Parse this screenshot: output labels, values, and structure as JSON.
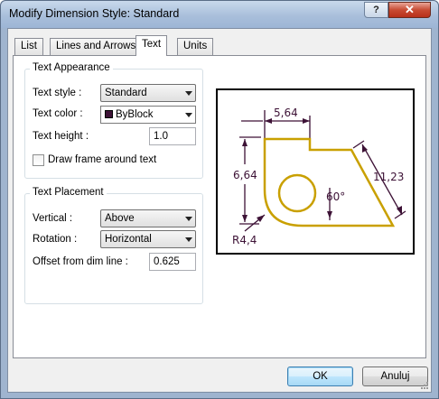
{
  "window": {
    "title": "Modify Dimension Style: Standard",
    "help_label": "?",
    "close_label": "✕"
  },
  "tabs": [
    {
      "label": "List",
      "active": false
    },
    {
      "label": "Lines and Arrows",
      "active": false
    },
    {
      "label": "Text",
      "active": true
    },
    {
      "label": "Units",
      "active": false
    }
  ],
  "text_appearance": {
    "title": "Text Appearance",
    "text_style_label": "Text style :",
    "text_style_value": "Standard",
    "text_color_label": "Text color :",
    "text_color_value": "ByBlock",
    "text_color_swatch": "#3d1236",
    "text_height_label": "Text height :",
    "text_height_value": "1.0",
    "draw_frame_label": "Draw frame around text",
    "draw_frame_checked": false
  },
  "text_placement": {
    "title": "Text Placement",
    "vertical_label": "Vertical :",
    "vertical_value": "Above",
    "rotation_label": "Rotation :",
    "rotation_value": "Horizontal",
    "offset_label": "Offset from dim line :",
    "offset_value": "0.625"
  },
  "preview": {
    "dim_top": "5,64",
    "dim_left": "6,64",
    "dim_diag": "11,23",
    "dim_angle": "60°",
    "dim_radius": "R4,4",
    "shape_color": "#c9a000",
    "dim_color": "#3d1236"
  },
  "buttons": {
    "ok": "OK",
    "cancel": "Anuluj"
  }
}
